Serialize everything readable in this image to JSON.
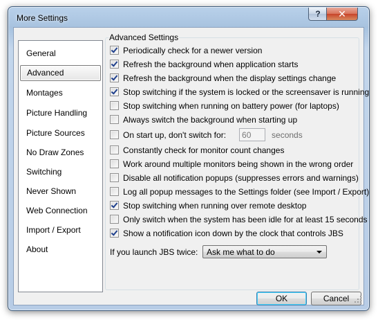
{
  "window": {
    "title": "More Settings",
    "help_glyph": "?",
    "close_glyph": "✕"
  },
  "sidebar": {
    "items": [
      {
        "label": "General"
      },
      {
        "label": "Advanced",
        "selected": true
      },
      {
        "label": "Montages"
      },
      {
        "label": "Picture Handling"
      },
      {
        "label": "Picture Sources"
      },
      {
        "label": "No Draw Zones"
      },
      {
        "label": "Switching"
      },
      {
        "label": "Never Shown"
      },
      {
        "label": "Web Connection"
      },
      {
        "label": "Import / Export"
      },
      {
        "label": "About"
      }
    ]
  },
  "advanced": {
    "group_title": "Advanced Settings",
    "options": [
      {
        "label": "Periodically check for a newer version",
        "checked": true
      },
      {
        "label": "Refresh the background when application starts",
        "checked": true
      },
      {
        "label": "Refresh the background when the display settings change",
        "checked": true
      },
      {
        "label": "Stop switching if the system is locked or the screensaver is running",
        "checked": true
      },
      {
        "label": "Stop switching when running on battery power (for laptops)",
        "checked": false
      },
      {
        "label": "Always switch the background when starting up",
        "checked": false
      },
      {
        "label": "On start up, don't switch for:",
        "checked": false
      },
      {
        "label": "Constantly check for monitor count changes",
        "checked": false
      },
      {
        "label": "Work around multiple monitors being shown in the wrong order",
        "checked": false
      },
      {
        "label": "Disable all notification popups (suppresses errors and warnings)",
        "checked": false
      },
      {
        "label": "Log all popup messages to the Settings folder (see Import / Export)",
        "checked": false
      },
      {
        "label": "Stop switching when running over remote desktop",
        "checked": true
      },
      {
        "label": "Only switch when the system has been idle for at least 15 seconds",
        "checked": false
      },
      {
        "label": "Show a notification icon down by the clock that controls JBS",
        "checked": true
      }
    ],
    "startup_delay_value": "60",
    "startup_delay_unit": "seconds",
    "launch_label": "If you launch JBS twice:",
    "launch_selected": "Ask me what to do"
  },
  "buttons": {
    "ok": "OK",
    "cancel": "Cancel"
  }
}
